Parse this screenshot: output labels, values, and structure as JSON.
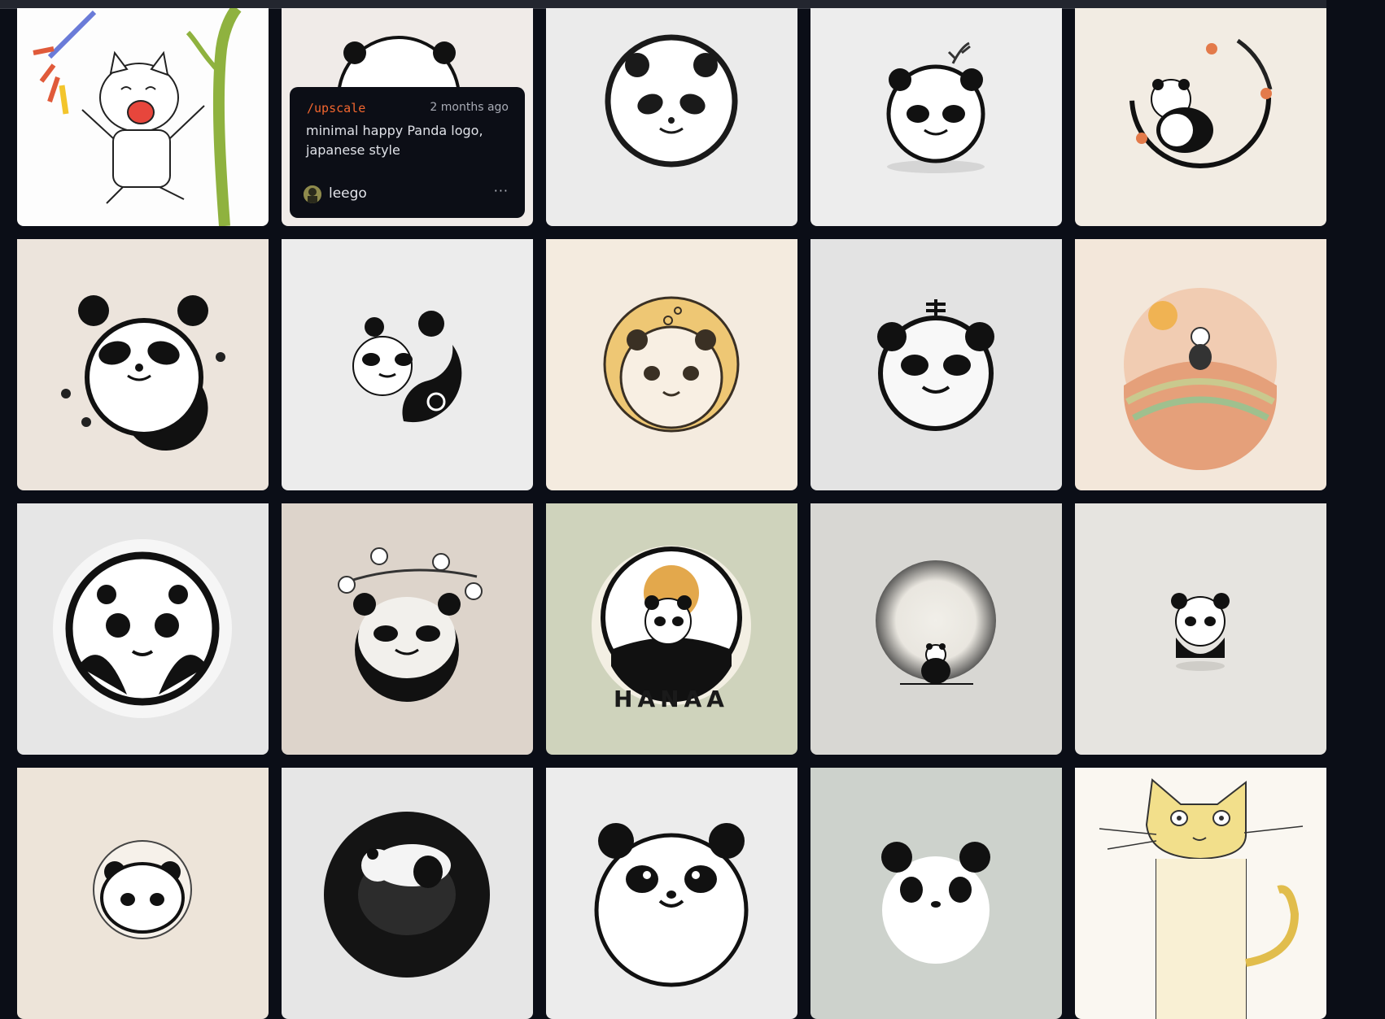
{
  "tooltip": {
    "command": "/upscale",
    "time_ago": "2 months ago",
    "prompt": "minimal happy Panda logo, japanese style",
    "username": "leego",
    "more_icon": "ellipsis-icon"
  },
  "colors": {
    "page_bg": "#0b0e17",
    "command_accent": "#f2662f"
  },
  "tiles": [
    "cat-doodle-under-tree",
    "panda-logo-upscaled",
    "panda-circle-logo",
    "panda-with-sprout",
    "panda-cherry-branch-ring",
    "panda-with-flowers",
    "panda-yin-yang",
    "panda-yellow-bubble",
    "panda-cross-hat",
    "panda-sunset-hills",
    "panda-big-circle",
    "panda-cherry-blossoms",
    "panda-hanaa-badge",
    "panda-gradient-moon",
    "panda-sitting-small",
    "panda-in-circle",
    "panda-black-circle",
    "panda-face-large",
    "panda-face-sage",
    "yellow-cat-sketch"
  ]
}
